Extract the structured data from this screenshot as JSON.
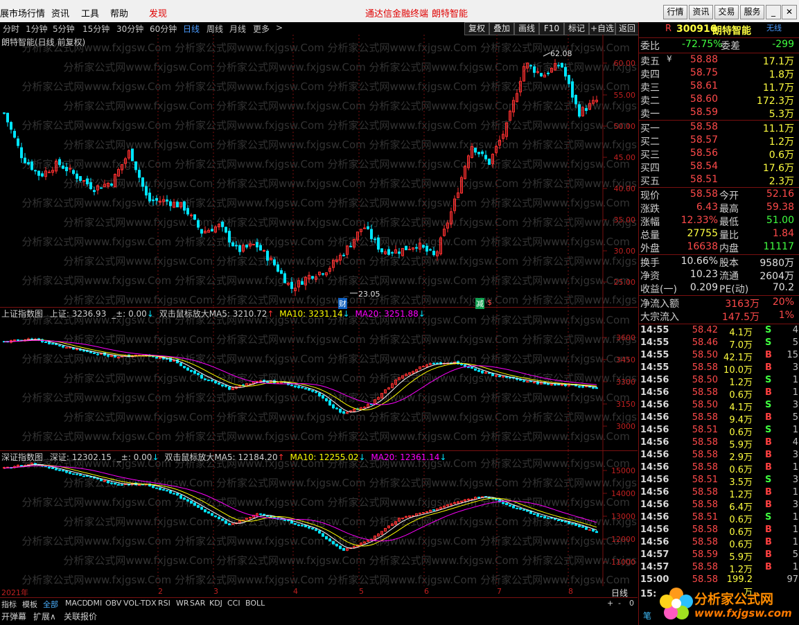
{
  "menu": {
    "items": [
      "展市场行情",
      "资讯",
      "工具",
      "帮助"
    ],
    "discover": "发现",
    "center_title": "通达信金融终端",
    "stock_name": "朗特智能",
    "right_buttons": [
      "行情",
      "资讯",
      "交易",
      "服务"
    ]
  },
  "periods": [
    "分时",
    "1分钟",
    "5分钟",
    "15分钟",
    "30分钟",
    "60分钟",
    "日线",
    "周线",
    "月线",
    "更多"
  ],
  "active_period": "日线",
  "more_arrow": ">",
  "tools": [
    "复权",
    "叠加",
    "画线",
    "F10",
    "标记",
    "+自选",
    "返回"
  ],
  "main_chart": {
    "title": "朗特智能(日线 前复权)",
    "high_label": "62.08",
    "low_label": "23.05",
    "y_ticks": [
      "60.00",
      "55.00",
      "50.00",
      "45.00",
      "40.00",
      "35.00",
      "30.00",
      "25.00"
    ],
    "markers": [
      "财",
      "减",
      "$"
    ]
  },
  "sh_chart": {
    "title": "上证指数图",
    "label": "上证: 3236.93",
    "pm": "_±: 0.00",
    "ma_label": "双击鼠标放大MA5: 3210.72",
    "ma10": "MA10: 3231.14",
    "ma20": "MA20: 3251.88",
    "y_ticks": [
      "3600",
      "3450",
      "3300",
      "3150",
      "3000"
    ]
  },
  "sz_chart": {
    "title": "深证指数图",
    "label": "深证: 12302.15",
    "pm": "_±: 0.00",
    "ma_label": "双击鼠标放大MA5: 12184.20",
    "ma10": "MA10: 12255.02",
    "ma20": "MA20: 12361.14",
    "y_ticks": [
      "15000",
      "14000",
      "13000",
      "12000",
      "11000"
    ]
  },
  "time_axis": [
    "2021年",
    "2",
    "3",
    "4",
    "5",
    "6",
    "7",
    "8"
  ],
  "watermark": "分析家公式网www.fxjgsw.Com",
  "period_label": "日线",
  "tabs": [
    "指标",
    "模板",
    "全部",
    "MACD",
    "DMI",
    "OBV",
    "VOL-TDX",
    "RSI",
    "WR",
    "SAR",
    "KDJ",
    "CCI",
    "BOLL"
  ],
  "bottom": [
    "开弹幕",
    "扩展∧",
    "关联报价"
  ],
  "nav_symbols": [
    "+",
    "-",
    "0"
  ],
  "quote": {
    "code": "300916",
    "name": "朗特智能",
    "wuxian": "无线",
    "r": "R",
    "weibi_label": "委比",
    "weibi": "-72.75%",
    "weicha_label": "委差",
    "weicha": "-299",
    "asks": [
      {
        "label": "卖五",
        "mark": "¥",
        "price": "58.88",
        "vol": "17.1万"
      },
      {
        "label": "卖四",
        "mark": "",
        "price": "58.75",
        "vol": "1.8万"
      },
      {
        "label": "卖三",
        "mark": "",
        "price": "58.61",
        "vol": "11.7万"
      },
      {
        "label": "卖二",
        "mark": "",
        "price": "58.60",
        "vol": "172.3万"
      },
      {
        "label": "卖一",
        "mark": "",
        "price": "58.59",
        "vol": "5.3万"
      }
    ],
    "bids": [
      {
        "label": "买一",
        "price": "58.58",
        "vol": "11.1万"
      },
      {
        "label": "买二",
        "price": "58.57",
        "vol": "1.2万"
      },
      {
        "label": "买三",
        "price": "58.56",
        "vol": "0.6万"
      },
      {
        "label": "买四",
        "price": "58.54",
        "vol": "17.6万"
      },
      {
        "label": "买五",
        "price": "58.51",
        "vol": "2.3万"
      }
    ],
    "stats": [
      {
        "l1": "现价",
        "v1": "58.58",
        "l2": "今开",
        "v2": "52.16"
      },
      {
        "l1": "涨跌",
        "v1": "6.43",
        "l2": "最高",
        "v2": "59.38"
      },
      {
        "l1": "涨幅",
        "v1": "12.33%",
        "l2": "最低",
        "v2": "51.00"
      },
      {
        "l1": "总量",
        "v1": "27755",
        "l2": "量比",
        "v2": "1.84"
      },
      {
        "l1": "外盘",
        "v1": "16638",
        "l2": "内盘",
        "v2": "11117"
      }
    ],
    "fund": [
      {
        "l1": "换手",
        "v1": "10.66%",
        "l2": "股本",
        "v2": "9580万"
      },
      {
        "l1": "净资",
        "v1": "10.23",
        "l2": "流通",
        "v2": "2604万"
      },
      {
        "l1": "收益(一)",
        "v1": "0.209",
        "l2": "PE(动)",
        "v2": "70.2"
      }
    ],
    "flows": [
      {
        "label": "净流入额",
        "value": "3163万",
        "pct": "20%"
      },
      {
        "label": "大宗流入",
        "value": "147.5万",
        "pct": "1%"
      }
    ],
    "ticks": [
      {
        "t": "14:55",
        "p": "58.42",
        "v": "4.1万",
        "s": "S",
        "n": "4"
      },
      {
        "t": "14:55",
        "p": "58.46",
        "v": "7.0万",
        "s": "S",
        "n": "5"
      },
      {
        "t": "14:55",
        "p": "58.50",
        "v": "42.1万",
        "s": "B",
        "n": "15"
      },
      {
        "t": "14:55",
        "p": "58.58",
        "v": "10.0万",
        "s": "B",
        "n": "3"
      },
      {
        "t": "14:56",
        "p": "58.50",
        "v": "1.2万",
        "s": "S",
        "n": "1"
      },
      {
        "t": "14:56",
        "p": "58.58",
        "v": "0.6万",
        "s": "B",
        "n": "1"
      },
      {
        "t": "14:56",
        "p": "58.50",
        "v": "4.1万",
        "s": "S",
        "n": "3"
      },
      {
        "t": "14:56",
        "p": "58.58",
        "v": "9.4万",
        "s": "B",
        "n": "5"
      },
      {
        "t": "14:56",
        "p": "58.51",
        "v": "0.6万",
        "s": "S",
        "n": "1"
      },
      {
        "t": "14:56",
        "p": "58.58",
        "v": "5.9万",
        "s": "B",
        "n": "4"
      },
      {
        "t": "14:56",
        "p": "58.58",
        "v": "2.9万",
        "s": "B",
        "n": "3"
      },
      {
        "t": "14:56",
        "p": "58.58",
        "v": "0.6万",
        "s": "B",
        "n": "1"
      },
      {
        "t": "14:56",
        "p": "58.51",
        "v": "3.5万",
        "s": "S",
        "n": "3"
      },
      {
        "t": "14:56",
        "p": "58.58",
        "v": "1.2万",
        "s": "B",
        "n": "1"
      },
      {
        "t": "14:56",
        "p": "58.58",
        "v": "6.4万",
        "s": "B",
        "n": "3"
      },
      {
        "t": "14:56",
        "p": "58.51",
        "v": "0.6万",
        "s": "S",
        "n": "1"
      },
      {
        "t": "14:56",
        "p": "58.58",
        "v": "0.6万",
        "s": "B",
        "n": "1"
      },
      {
        "t": "14:56",
        "p": "58.58",
        "v": "0.6万",
        "s": "B",
        "n": "1"
      },
      {
        "t": "14:57",
        "p": "58.59",
        "v": "5.9万",
        "s": "B",
        "n": "5"
      },
      {
        "t": "14:57",
        "p": "58.58",
        "v": "1.2万",
        "s": "B",
        "n": "1"
      },
      {
        "t": "15:00",
        "p": "58.58",
        "v": "199.2万",
        "s": "",
        "n": "97"
      }
    ],
    "last_tick_time": "15:"
  },
  "logo": {
    "title": "分析家公式网",
    "url": "www.fxjgsw.com"
  },
  "corner_label": "笔",
  "colors": {
    "up": "#ff3030",
    "down": "#00e5ff",
    "ma5": "#ffffff",
    "ma10": "#ffff00",
    "ma20": "#ff00ff",
    "grid": "#7a1010"
  }
}
